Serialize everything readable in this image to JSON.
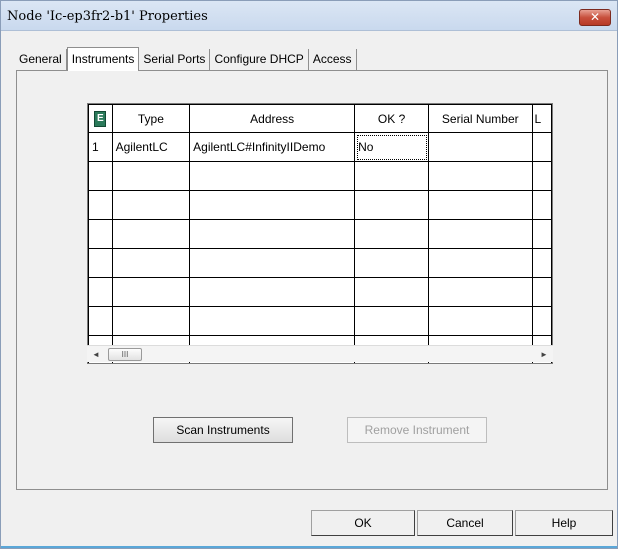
{
  "window": {
    "title": "Node 'Ic-ep3fr2-b1' Properties",
    "close_glyph": "✕"
  },
  "tabs": [
    {
      "label": "General"
    },
    {
      "label": "Instruments"
    },
    {
      "label": "Serial Ports"
    },
    {
      "label": "Configure DHCP"
    },
    {
      "label": "Access"
    }
  ],
  "grid": {
    "corner_icon": "E",
    "columns": [
      "Type",
      "Address",
      "OK ?",
      "Serial Number",
      "L"
    ],
    "rows": [
      {
        "num": "1",
        "type": "AgilentLC",
        "address": "AgilentLC#InfinityIIDemo",
        "ok": "No",
        "serial": "",
        "l": ""
      }
    ]
  },
  "scrollbar": {
    "left_arrow": "◄",
    "thumb": "III",
    "right_arrow": "►"
  },
  "buttons": {
    "scan": "Scan Instruments",
    "remove": "Remove Instrument",
    "ok": "OK",
    "cancel": "Cancel",
    "help": "Help"
  }
}
